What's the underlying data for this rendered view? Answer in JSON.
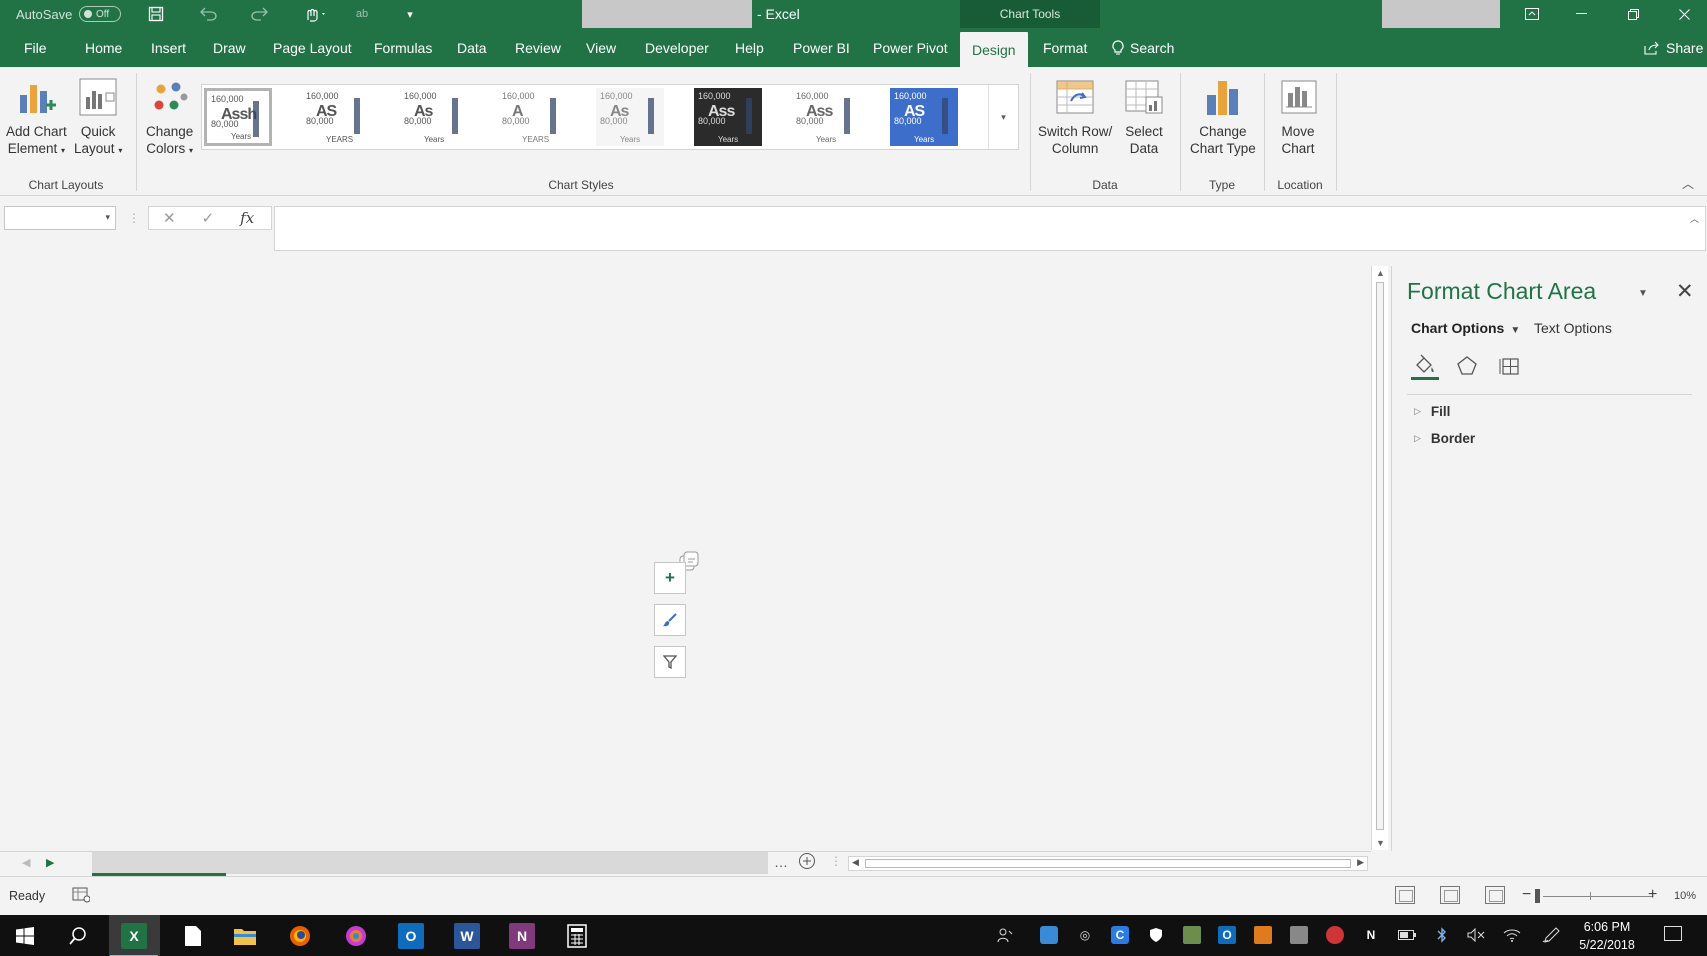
{
  "titlebar": {
    "autosave_label": "AutoSave",
    "autosave_state": "Off",
    "app_title": "- Excel",
    "contextual_group": "Chart Tools"
  },
  "tabs": [
    "File",
    "Home",
    "Insert",
    "Draw",
    "Page Layout",
    "Formulas",
    "Data",
    "Review",
    "View",
    "Developer",
    "Help",
    "Power BI",
    "Power Pivot",
    "Design",
    "Format"
  ],
  "active_tab": "Design",
  "search_label": "Search",
  "share_label": "Share",
  "ribbon": {
    "chart_layouts": {
      "group": "Chart Layouts",
      "add_chart_element": [
        "Add Chart",
        "Element"
      ],
      "quick_layout": [
        "Quick",
        "Layout"
      ]
    },
    "chart_styles": {
      "group": "Chart Styles",
      "change_colors": [
        "Change",
        "Colors"
      ],
      "styles": [
        {
          "num": "160,000",
          "big": "Assh",
          "axis": "80,000",
          "foot": "Years",
          "bg": "#ffffff",
          "fg": "#555555"
        },
        {
          "num": "160,000",
          "big": "AS",
          "axis": "80,000",
          "foot": "YEARS",
          "bg": "#ffffff",
          "fg": "#555555"
        },
        {
          "num": "160,000",
          "big": "As",
          "axis": "80,000",
          "foot": "Years",
          "bg": "#ffffff",
          "fg": "#555555"
        },
        {
          "num": "160,000",
          "big": "A",
          "axis": "80,000",
          "foot": "YEARS",
          "bg": "#ffffff",
          "fg": "#777777"
        },
        {
          "num": "160,000",
          "big": "As",
          "axis": "80,000",
          "foot": "Years",
          "bg": "#f5f5f5",
          "fg": "#888888"
        },
        {
          "num": "160,000",
          "big": "Ass",
          "axis": "80,000",
          "foot": "Years",
          "bg": "#2b2b2b",
          "fg": "#dddddd"
        },
        {
          "num": "160,000",
          "big": "Ass",
          "axis": "80,000",
          "foot": "Years",
          "bg": "#ffffff",
          "fg": "#666666"
        },
        {
          "num": "160,000",
          "big": "AS",
          "axis": "80,000",
          "foot": "Years",
          "bg": "#3d6ec9",
          "fg": "#ffffff"
        }
      ]
    },
    "data": {
      "group": "Data",
      "switch_row_column": [
        "Switch Row/",
        "Column"
      ],
      "select_data": [
        "Select",
        "Data"
      ]
    },
    "type": {
      "group": "Type",
      "change_chart_type": [
        "Change",
        "Chart Type"
      ]
    },
    "location": {
      "group": "Location",
      "move_chart": [
        "Move",
        "Chart"
      ]
    }
  },
  "formula_bar": {
    "fx": "fx",
    "cancel": "✕",
    "enter": "✓"
  },
  "format_pane": {
    "title": "Format Chart Area",
    "tab_chart_options": "Chart Options",
    "tab_text_options": "Text Options",
    "icons": [
      "fill-line-icon",
      "effects-icon",
      "size-properties-icon"
    ],
    "sections": [
      "Fill",
      "Border"
    ]
  },
  "status": {
    "ready": "Ready",
    "zoom": "10%"
  },
  "clock": {
    "time": "6:06 PM",
    "date": "5/22/2018"
  },
  "colors": {
    "brand": "#217346",
    "taskbar": "#101010"
  }
}
